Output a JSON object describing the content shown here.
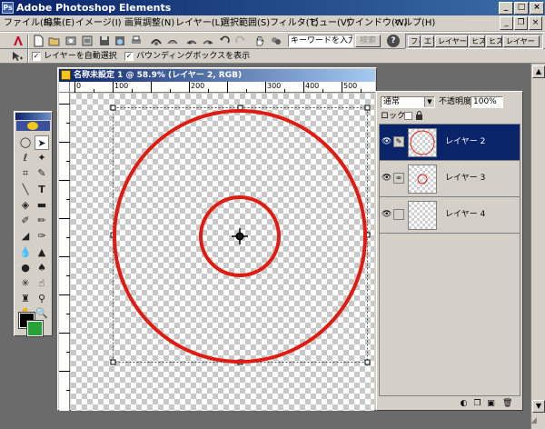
{
  "app": {
    "title": "Adobe Photoshop Elements",
    "logo_letter": "Ps"
  },
  "window_controls": {
    "minimize": "_",
    "maximize": "□",
    "close": "×"
  },
  "menu": {
    "items": [
      "ファイル(F)",
      "編集(E)",
      "イメージ(I)",
      "画質調整(N)",
      "レイヤー(L)",
      "選択範囲(S)",
      "フィルタ(T)",
      "ビュー(V)",
      "ウインドウ(W)",
      "ヘルプ(H)"
    ],
    "doc_controls": {
      "minimize": "_",
      "restore": "❐",
      "close": "×"
    }
  },
  "shortcuts": {
    "search_placeholder": "キーワードを入力",
    "search_button": "検索",
    "help_icon": "help-icon",
    "palette_tabs": [
      "フィ",
      "エフ",
      "レイヤー",
      "ヒス",
      "ヒス",
      "レイヤー"
    ]
  },
  "options": {
    "auto_select_label": "レイヤーを自動選択",
    "auto_select_checked": true,
    "bounding_box_label": "バウンディングボックスを表示",
    "bounding_box_checked": true
  },
  "document": {
    "title": "名称未設定 1 @ 58.9% (レイヤー 2, RGB)",
    "ruler_labels": [
      "0",
      "100",
      "200",
      "300",
      "400",
      "500"
    ],
    "circle_color": "#e01b12"
  },
  "layers": {
    "blend_mode": "通常",
    "opacity_label": "不透明度:",
    "opacity_value": "100%",
    "lock_label": "ロック:",
    "items": [
      {
        "name": "レイヤー 2",
        "selected": true,
        "visible": true,
        "link": "brush"
      },
      {
        "name": "レイヤー 3",
        "selected": false,
        "visible": true,
        "link": "chain"
      },
      {
        "name": "レイヤー 4",
        "selected": false,
        "visible": true,
        "link": ""
      }
    ]
  },
  "toolbox": {
    "foreground_color": "#000000",
    "background_color": "#26a337"
  }
}
